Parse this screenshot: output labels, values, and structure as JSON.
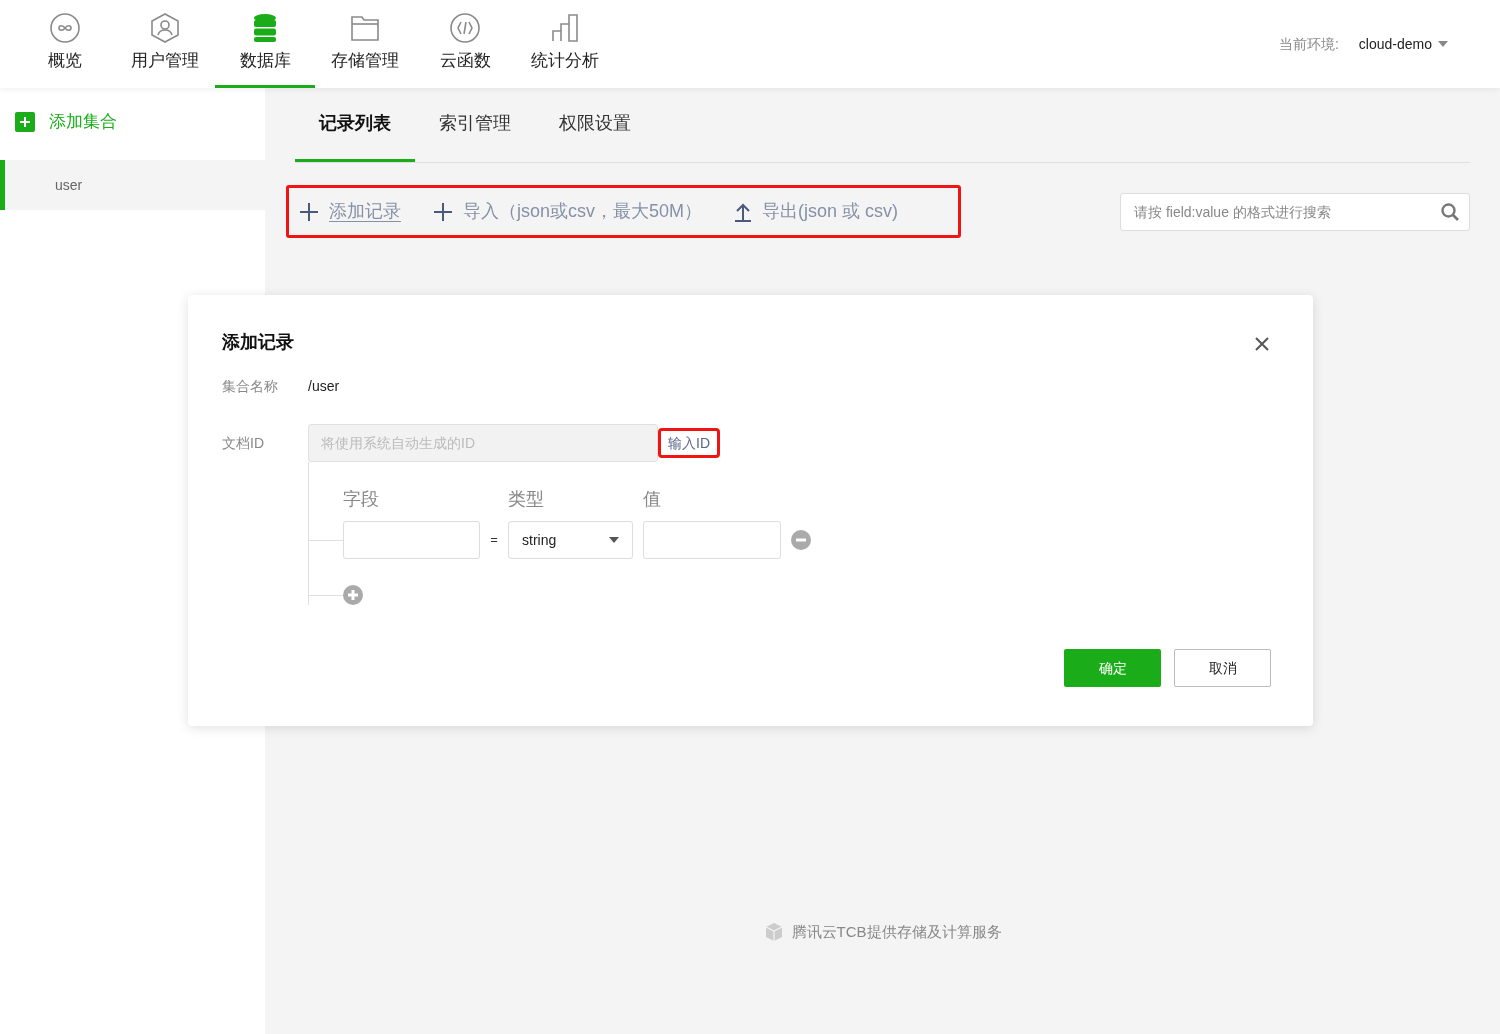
{
  "nav": {
    "items": [
      {
        "label": "概览",
        "kind": "overview",
        "selected": false
      },
      {
        "label": "用户管理",
        "kind": "user",
        "selected": false
      },
      {
        "label": "数据库",
        "kind": "database",
        "selected": true
      },
      {
        "label": "存储管理",
        "kind": "folder",
        "selected": false
      },
      {
        "label": "云函数",
        "kind": "function",
        "selected": false
      },
      {
        "label": "统计分析",
        "kind": "chart",
        "selected": false
      }
    ],
    "env_label": "当前环境:",
    "env_value": "cloud-demo"
  },
  "sidebar": {
    "add_label": "添加集合",
    "items": [
      {
        "label": "user",
        "selected": true
      }
    ]
  },
  "tabs": [
    {
      "label": "记录列表",
      "selected": true
    },
    {
      "label": "索引管理",
      "selected": false
    },
    {
      "label": "权限设置",
      "selected": false
    }
  ],
  "toolbar": {
    "highlighted": true,
    "actions": [
      {
        "kind": "add",
        "label": "添加记录",
        "underlined": true
      },
      {
        "kind": "add",
        "label": "导入（json或csv，最大50M）",
        "underlined": false
      },
      {
        "kind": "export",
        "label": "导出(json 或 csv)",
        "underlined": false
      }
    ]
  },
  "search": {
    "placeholder": "请按 field:value 的格式进行搜索"
  },
  "dialog": {
    "title": "添加记录",
    "collection_label": "集合名称",
    "collection_value": "/user",
    "doc_id_label": "文档ID",
    "doc_id_placeholder": "将使用系统自动生成的ID",
    "doc_id_link": "输入ID",
    "doc_id_link_highlighted": true,
    "field_headers": [
      "字段",
      "类型",
      "值"
    ],
    "rows": [
      {
        "equals": "=",
        "type": "string"
      }
    ],
    "ok": "确定",
    "cancel": "取消"
  },
  "footer": "腾讯云TCB提供存储及计算服务"
}
